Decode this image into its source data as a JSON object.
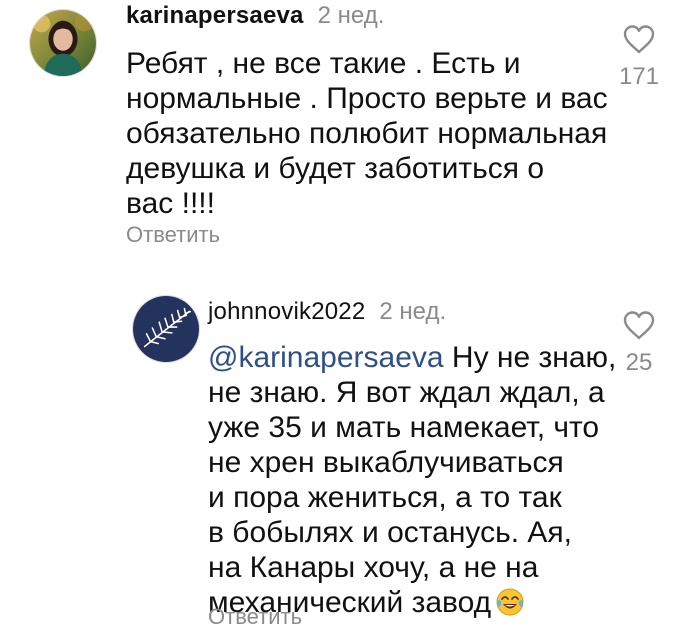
{
  "comments": [
    {
      "username": "karinapersaeva",
      "time": "2 нед.",
      "lines": [
        "Ребят , не все такие . Есть и",
        "нормальные . Просто верьте и вас",
        "обязательно полюбит нормальная",
        "девушка и будет заботиться о",
        "вас !!!!"
      ],
      "reply_label": "Ответить",
      "likes": "171",
      "avatar_icon": "woman-portrait-avatar",
      "like_icon": "heart-outline-icon"
    },
    {
      "username": "johnnovik2022",
      "time": "2 нед.",
      "mention": "@karinapersaeva",
      "lines": [
        " Ну не знаю,",
        "не знаю. Я вот ждал ждал, а",
        "уже 35 и мать намекает, что",
        "не хрен выкаблучиваться",
        "и пора жениться, а то так",
        "в бобылях и останусь. Ая,",
        "на Канары хочу, а не на",
        "механический завод"
      ],
      "emoji_icon": "face-with-tears-of-joy-icon",
      "reply_label": "Ответить",
      "likes": "25",
      "avatar_icon": "white-fern-avatar",
      "like_icon": "heart-outline-icon"
    }
  ],
  "colors": {
    "text": "#111111",
    "muted": "#8a8a8a",
    "mention": "#2f4f8a",
    "background": "#ffffff"
  }
}
